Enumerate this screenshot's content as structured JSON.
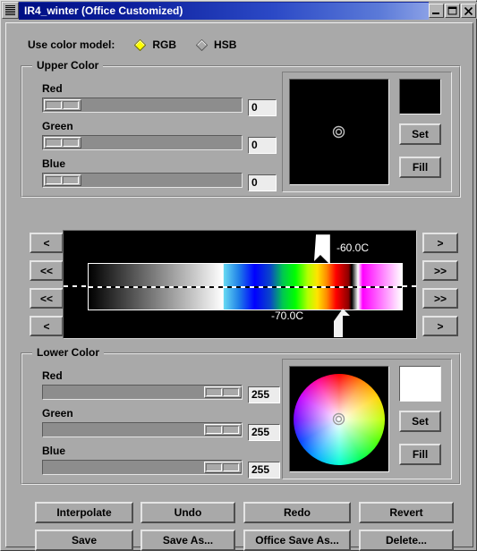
{
  "window": {
    "title": "IR4_winter (Office Customized)",
    "menu_icon": "menu-stripes-icon",
    "controls": [
      {
        "name": "minimize",
        "glyph": "minimize-icon"
      },
      {
        "name": "maximize",
        "glyph": "maximize-icon"
      },
      {
        "name": "close",
        "glyph": "close-icon"
      }
    ],
    "titlebar_gradient_start": "#000f84",
    "titlebar_gradient_end": "#8aa0e6",
    "face_color": "#a9a9a9"
  },
  "color_model": {
    "label": "Use color model:",
    "options": [
      {
        "label": "RGB",
        "selected": true,
        "marker_color": "#ffff00"
      },
      {
        "label": "HSB",
        "selected": false,
        "marker_color": "#a9a9a9"
      }
    ]
  },
  "upper_color": {
    "title": "Upper Color",
    "channels": [
      {
        "label": "Red",
        "value": "0",
        "percent": 0
      },
      {
        "label": "Green",
        "value": "0",
        "percent": 0
      },
      {
        "label": "Blue",
        "value": "0",
        "percent": 0
      }
    ],
    "wheel": {
      "name": "color-wheel",
      "brightness": 0,
      "marker": "target-icon"
    },
    "swatch_color": "#000000",
    "set_label": "Set",
    "fill_label": "Fill"
  },
  "lower_color": {
    "title": "Lower Color",
    "channels": [
      {
        "label": "Red",
        "value": "255",
        "percent": 100
      },
      {
        "label": "Green",
        "value": "255",
        "percent": 100
      },
      {
        "label": "Blue",
        "value": "255",
        "percent": 100
      }
    ],
    "wheel": {
      "name": "color-wheel",
      "brightness": 1,
      "marker": "target-icon"
    },
    "swatch_color": "#ffffff",
    "set_label": "Set",
    "fill_label": "Fill"
  },
  "palette_strip": {
    "upper_temperature": "-60.0C",
    "lower_temperature": "-70.0C",
    "upper_marker_position_pct": 82.8,
    "lower_marker_position_pct": 84.5,
    "left_buttons": [
      {
        "label": "<",
        "name": "nav-left-single-top"
      },
      {
        "label": "<<",
        "name": "nav-left-double-top"
      },
      {
        "label": "<<",
        "name": "nav-left-double-bottom"
      },
      {
        "label": "<",
        "name": "nav-left-single-bottom"
      }
    ],
    "right_buttons": [
      {
        "label": ">",
        "name": "nav-right-single-top"
      },
      {
        "label": ">>",
        "name": "nav-right-double-top"
      },
      {
        "label": ">>",
        "name": "nav-right-double-bottom"
      },
      {
        "label": ">",
        "name": "nav-right-single-bottom"
      }
    ],
    "gradient_stops": [
      {
        "pos": 0,
        "color": "#000000"
      },
      {
        "pos": 43,
        "color": "#ffffff"
      },
      {
        "pos": 43.2,
        "color": "#66d9f2"
      },
      {
        "pos": 48,
        "color": "#1f7fe8"
      },
      {
        "pos": 53,
        "color": "#0000ff"
      },
      {
        "pos": 58,
        "color": "#0a46c8"
      },
      {
        "pos": 62,
        "color": "#00c850"
      },
      {
        "pos": 66,
        "color": "#00ff00"
      },
      {
        "pos": 70,
        "color": "#b4ff00"
      },
      {
        "pos": 73,
        "color": "#ffe400"
      },
      {
        "pos": 76,
        "color": "#ff8c00"
      },
      {
        "pos": 79,
        "color": "#ff0000"
      },
      {
        "pos": 83,
        "color": "#8b0000"
      },
      {
        "pos": 84,
        "color": "#000000"
      },
      {
        "pos": 86,
        "color": "#ffffff"
      },
      {
        "pos": 87.5,
        "color": "#ff00ff"
      },
      {
        "pos": 100,
        "color": "#ffffff"
      }
    ]
  },
  "actions": {
    "row1": [
      {
        "label": "Interpolate",
        "name": "interpolate-button"
      },
      {
        "label": "Undo",
        "name": "undo-button"
      },
      {
        "label": "Redo",
        "name": "redo-button"
      },
      {
        "label": "Revert",
        "name": "revert-button"
      }
    ],
    "row2": [
      {
        "label": "Save",
        "name": "save-button"
      },
      {
        "label": "Save As...",
        "name": "save-as-button"
      },
      {
        "label": "Office Save As...",
        "name": "office-save-as-button"
      },
      {
        "label": "Delete...",
        "name": "delete-button"
      }
    ]
  }
}
